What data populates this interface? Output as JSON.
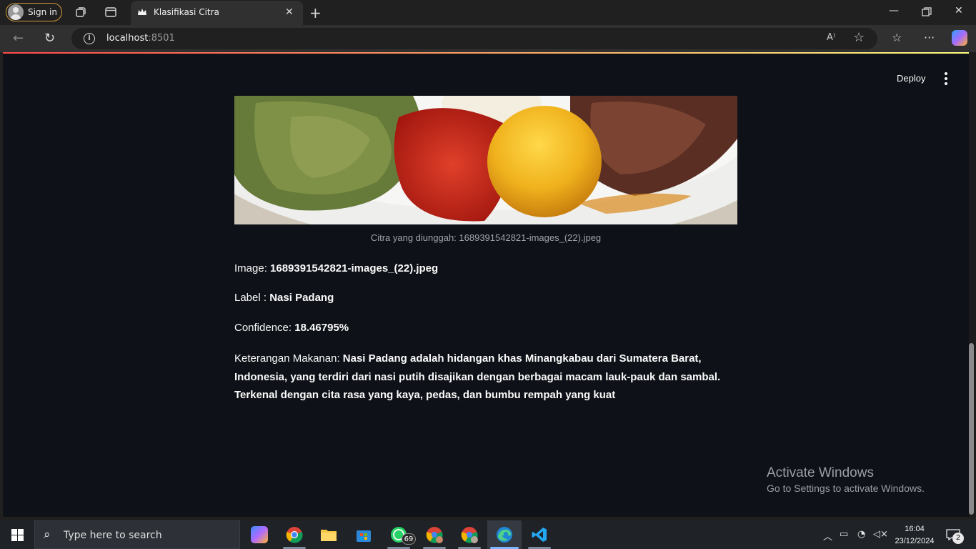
{
  "browser": {
    "signin_label": "Sign in",
    "tab_title": "Klasifikasi Citra",
    "url_host": "localhost",
    "url_port": ":8501",
    "read_aloud_glyph": "A⁾"
  },
  "app": {
    "deploy_label": "Deploy",
    "image_caption": "Citra yang diunggah: 1689391542821-images_(22).jpeg",
    "image_prefix": "Image: ",
    "image_name": "1689391542821-images_(22).jpeg",
    "label_prefix": "Label : ",
    "label_value": "Nasi Padang",
    "confidence_prefix": "Confidence: ",
    "confidence_value": "18.46795%",
    "desc_prefix": "Keterangan Makanan: ",
    "desc_value": "Nasi Padang adalah hidangan khas Minangkabau dari Sumatera Barat, Indonesia, yang terdiri dari nasi putih disajikan dengan berbagai macam lauk-pauk dan sambal. Terkenal dengan cita rasa yang kaya, pedas, dan bumbu rempah yang kuat"
  },
  "watermark": {
    "line1": "Activate Windows",
    "line2": "Go to Settings to activate Windows."
  },
  "taskbar": {
    "search_placeholder": "Type here to search",
    "whatsapp_badge": "69",
    "time": "16:04",
    "date": "23/12/2024",
    "notifications": "2"
  },
  "colors": {
    "streamlit_bg": "#0e1117",
    "accent_gradient_start": "#ff4b4b",
    "accent_gradient_end": "#fffd80"
  }
}
